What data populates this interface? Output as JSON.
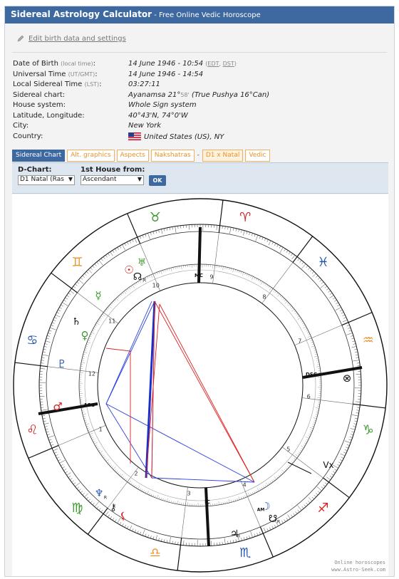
{
  "header": {
    "title": "Sidereal Astrology Calculator",
    "subtitle": "- Free Online Vedic Horoscope"
  },
  "edit_link": "Edit birth data and settings",
  "info": {
    "dob_label": "Date of Birth",
    "dob_label_small": "(local time)",
    "dob_value": "14 June 1946 - 10:54",
    "dob_edt": "EDT",
    "dob_dst": "DST",
    "ut_label": "Universal Time",
    "ut_label_small": "(UT/GMT)",
    "ut_value": "14 June 1946 - 14:54",
    "lst_label": "Local Sidereal Time",
    "lst_label_small": "(LST)",
    "lst_value": "03:27:11",
    "chart_label": "Sidereal chart:",
    "chart_value_a": "Ayanamsa 21°",
    "chart_value_b": "58'",
    "chart_value_c": " (True Pushya 16°Can)",
    "house_label": "House system:",
    "house_value": "Whole Sign system",
    "latlon_label": "Latitude, Longitude:",
    "latlon_value": "40°43'N, 74°0'W",
    "city_label": "City:",
    "city_value": "New York",
    "country_label": "Country:",
    "country_value": "United States (US), NY"
  },
  "tabs": {
    "sidereal_chart": "Sidereal Chart",
    "alt_graphics": "Alt. graphics",
    "aspects": "Aspects",
    "nakshatras": "Nakshatras",
    "dash": "-",
    "d1_natal": "D1 x Natal",
    "vedic": "Vedic"
  },
  "dchart": {
    "dchart_label": "D-Chart:",
    "dchart_value": "D1 Natal (Ras",
    "house_from_label": "1st House from:",
    "house_from_value": "Ascendant",
    "ok_label": "OK"
  },
  "wheel": {
    "signs": [
      "♈",
      "♉",
      "♊",
      "♋",
      "♌",
      "♍",
      "♎",
      "♏",
      "♐",
      "♑",
      "♒",
      "♓"
    ],
    "sign_colors": [
      "#d62020",
      "#3a9a2a",
      "#e8932a",
      "#2255aa",
      "#d62020",
      "#3a9a2a",
      "#e8932a",
      "#2255aa",
      "#d62020",
      "#3a9a2a",
      "#e8932a",
      "#2255aa"
    ],
    "houses": [
      "1",
      "2",
      "3",
      "4",
      "5",
      "6",
      "7",
      "8",
      "9",
      "10",
      "11",
      "12"
    ],
    "angles": {
      "asc": "ASC",
      "dsc": "DSC",
      "mc": "MC",
      "ic": "IC",
      "vx": "Vx"
    },
    "planets": {
      "sun": "☉",
      "mercury": "☿",
      "venus": "♀",
      "moon": "☽",
      "mars": "♂",
      "jupiter": "♃",
      "saturn": "♄",
      "uranus": "♅",
      "neptune": "♆",
      "pluto": "♇",
      "node_n": "☊",
      "node_s": "☋",
      "chiron": "⚷",
      "lilith": "⚸",
      "fortune": "⊗",
      "retro": "R",
      "am": "AM"
    }
  },
  "watermark": {
    "line1": "Online horoscopes",
    "line2": "www.Astro-Seek.com"
  }
}
